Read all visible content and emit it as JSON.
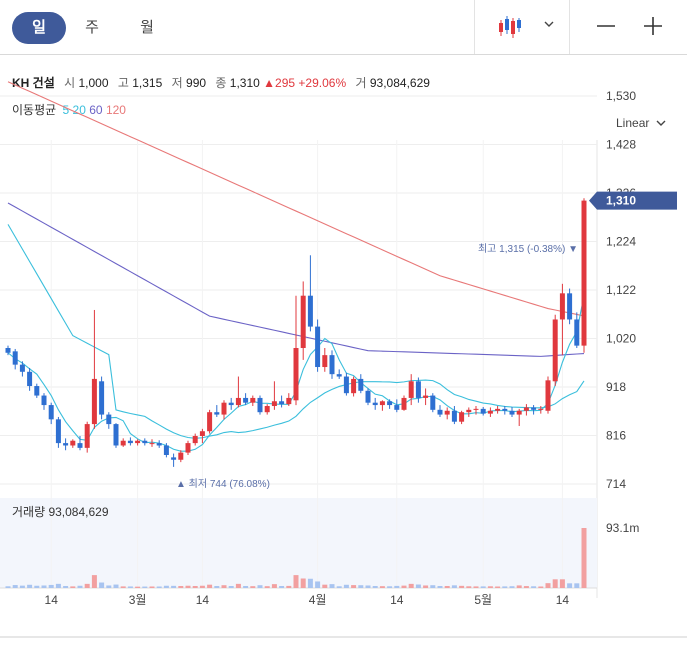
{
  "tabs": [
    {
      "label": "일",
      "active": true
    },
    {
      "label": "주",
      "active": false
    },
    {
      "label": "월",
      "active": false
    }
  ],
  "toolbar": {
    "chart_type_icon": "candlestick-icon",
    "dropdown_icon": "chevron-down-icon",
    "zoom_out_icon": "minus-icon",
    "zoom_in_icon": "plus-icon"
  },
  "stock": {
    "name": "KH 건설",
    "open_label": "시",
    "open": "1,000",
    "high_label": "고",
    "high": "1,315",
    "low_label": "저",
    "low": "990",
    "close_label": "종",
    "close": "1,310",
    "change": "▲295",
    "change_pct": "+29.06%",
    "volume_label": "거",
    "volume": "93,084,629"
  },
  "ma_legend": {
    "title": "이동평균",
    "items": [
      {
        "label": "5",
        "color": "#3bbfdc"
      },
      {
        "label": "20",
        "color": "#3bbfdc"
      },
      {
        "label": "60",
        "color": "#6b63c6"
      },
      {
        "label": "120",
        "color": "#e87878"
      }
    ]
  },
  "scale_label": "Linear",
  "colors": {
    "up": "#e0383e",
    "down": "#2e6fd1",
    "price_tag": "#3f5a9a",
    "vol_up": "#f2a0a0",
    "vol_down": "#a8c4f0"
  },
  "chart_data": {
    "type": "candlestick",
    "y_ticks": [
      "1,530",
      "1,428",
      "1,326",
      "1,224",
      "1,122",
      "1,020",
      "918",
      "816",
      "714"
    ],
    "ylim": [
      714,
      1530
    ],
    "x_tick_labels": [
      "14",
      "3월",
      "14",
      "4월",
      "14",
      "5월",
      "14"
    ],
    "current_price_label": "1,310",
    "high_marker": "최고 1,315 (-0.38%)",
    "low_marker": "최저 744 (76.08%)",
    "volume_label": "거래량 93,084,629",
    "volume_axis_label": "93.1m",
    "volume_max": 93084629,
    "candles": [
      [
        1000,
        1005,
        985,
        990
      ],
      [
        993,
        998,
        955,
        965
      ],
      [
        965,
        972,
        940,
        950
      ],
      [
        950,
        958,
        910,
        920
      ],
      [
        920,
        925,
        895,
        900
      ],
      [
        900,
        905,
        870,
        880
      ],
      [
        880,
        885,
        840,
        850
      ],
      [
        850,
        855,
        790,
        800
      ],
      [
        800,
        810,
        785,
        795
      ],
      [
        795,
        808,
        790,
        805
      ],
      [
        800,
        815,
        785,
        790
      ],
      [
        790,
        845,
        780,
        840
      ],
      [
        840,
        1080,
        830,
        935
      ],
      [
        930,
        940,
        850,
        860
      ],
      [
        860,
        865,
        830,
        840
      ],
      [
        840,
        842,
        790,
        795
      ],
      [
        795,
        810,
        792,
        805
      ],
      [
        805,
        812,
        795,
        800
      ],
      [
        800,
        808,
        795,
        805
      ],
      [
        805,
        810,
        795,
        800
      ],
      [
        800,
        808,
        792,
        800
      ],
      [
        800,
        806,
        790,
        795
      ],
      [
        795,
        800,
        770,
        775
      ],
      [
        770,
        778,
        750,
        765
      ],
      [
        765,
        785,
        760,
        780
      ],
      [
        780,
        805,
        775,
        800
      ],
      [
        800,
        820,
        795,
        815
      ],
      [
        815,
        830,
        800,
        825
      ],
      [
        825,
        870,
        820,
        865
      ],
      [
        865,
        880,
        855,
        860
      ],
      [
        860,
        890,
        850,
        885
      ],
      [
        885,
        895,
        870,
        880
      ],
      [
        880,
        940,
        875,
        895
      ],
      [
        895,
        905,
        880,
        885
      ],
      [
        885,
        900,
        878,
        895
      ],
      [
        895,
        900,
        860,
        865
      ],
      [
        865,
        882,
        860,
        878
      ],
      [
        878,
        930,
        870,
        888
      ],
      [
        888,
        900,
        875,
        882
      ],
      [
        882,
        905,
        878,
        895
      ],
      [
        890,
        1110,
        880,
        1000
      ],
      [
        1000,
        1140,
        975,
        1110
      ],
      [
        1110,
        1195,
        1035,
        1045
      ],
      [
        1045,
        1060,
        950,
        960
      ],
      [
        960,
        1000,
        950,
        985
      ],
      [
        985,
        995,
        935,
        945
      ],
      [
        945,
        955,
        935,
        940
      ],
      [
        940,
        948,
        900,
        905
      ],
      [
        905,
        940,
        898,
        935
      ],
      [
        935,
        945,
        905,
        910
      ],
      [
        910,
        915,
        880,
        885
      ],
      [
        885,
        895,
        870,
        880
      ],
      [
        880,
        890,
        868,
        888
      ],
      [
        888,
        892,
        872,
        880
      ],
      [
        880,
        892,
        865,
        870
      ],
      [
        870,
        900,
        868,
        895
      ],
      [
        895,
        945,
        880,
        930
      ],
      [
        930,
        938,
        885,
        895
      ],
      [
        895,
        915,
        880,
        900
      ],
      [
        900,
        905,
        865,
        870
      ],
      [
        870,
        880,
        855,
        860
      ],
      [
        860,
        875,
        850,
        868
      ],
      [
        868,
        878,
        840,
        845
      ],
      [
        845,
        868,
        840,
        865
      ],
      [
        865,
        875,
        855,
        870
      ],
      [
        870,
        878,
        860,
        872
      ],
      [
        872,
        876,
        858,
        862
      ],
      [
        862,
        875,
        855,
        868
      ],
      [
        868,
        878,
        862,
        872
      ],
      [
        872,
        878,
        860,
        868
      ],
      [
        868,
        876,
        855,
        860
      ],
      [
        860,
        872,
        836,
        868
      ],
      [
        868,
        882,
        858,
        875
      ],
      [
        875,
        880,
        860,
        870
      ],
      [
        870,
        878,
        862,
        872
      ],
      [
        868,
        940,
        862,
        932
      ],
      [
        930,
        1070,
        920,
        1060
      ],
      [
        1060,
        1135,
        985,
        1115
      ],
      [
        1115,
        1125,
        1050,
        1060
      ],
      [
        1060,
        1075,
        1000,
        1005
      ],
      [
        1005,
        1315,
        990,
        1310
      ]
    ]
  }
}
